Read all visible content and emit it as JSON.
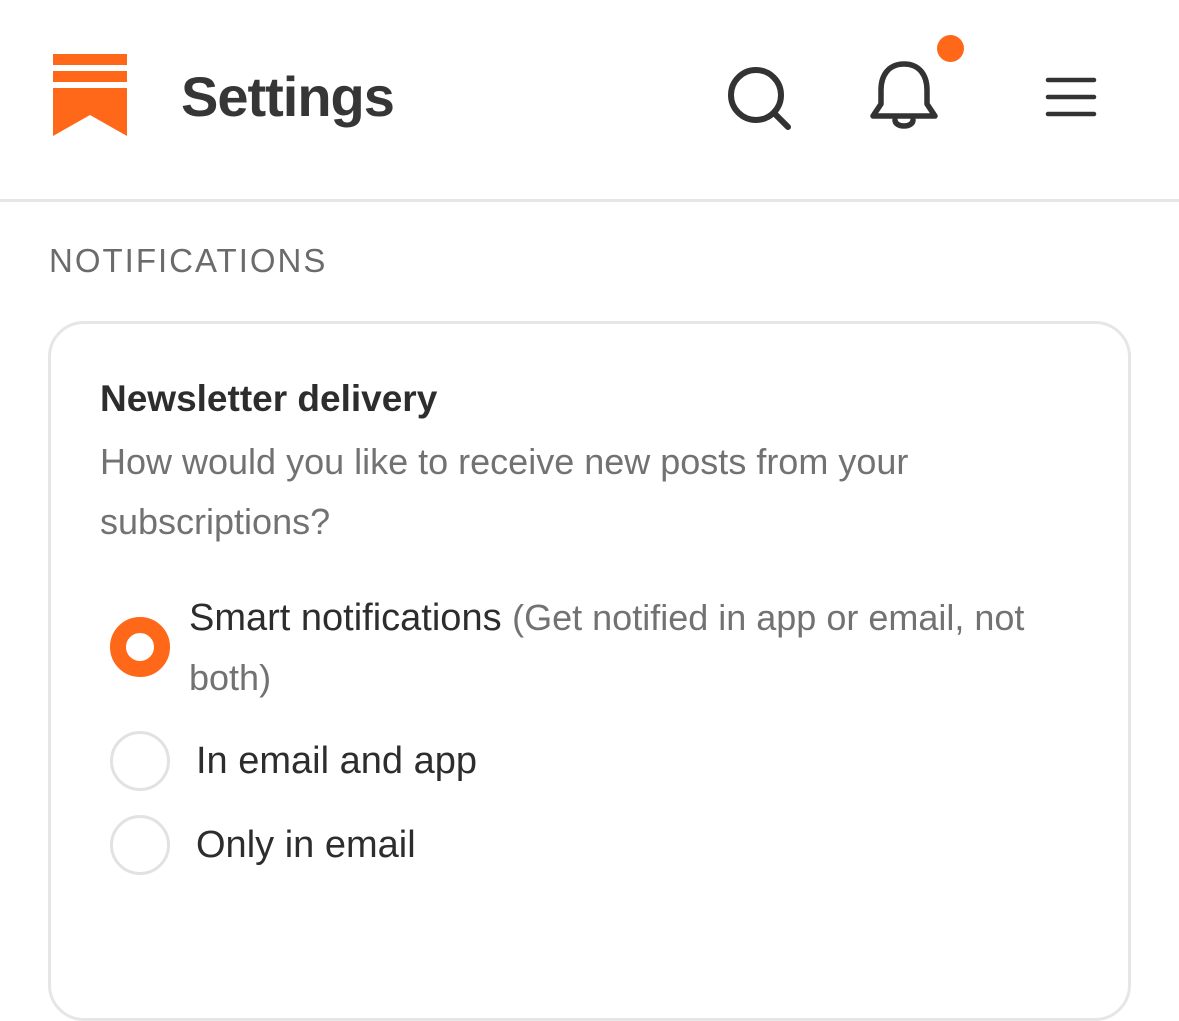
{
  "header": {
    "title": "Settings",
    "logo_icon": "bookmark-logo-icon",
    "search_icon": "search-icon",
    "bell_icon": "bell-icon",
    "menu_icon": "hamburger-menu-icon",
    "has_unread_notifications": true
  },
  "colors": {
    "accent": "#ff6719",
    "text_primary": "#2d2d2d",
    "text_secondary": "#727272",
    "border": "#e6e6e6"
  },
  "section": {
    "label": "NOTIFICATIONS"
  },
  "newsletter_delivery": {
    "title": "Newsletter delivery",
    "description": "How would you like to receive new posts from your subscriptions?",
    "selected_index": 0,
    "options": [
      {
        "label": "Smart notifications",
        "hint": "(Get notified in app or email, not both)",
        "selected": true
      },
      {
        "label": "In email and app",
        "hint": "",
        "selected": false
      },
      {
        "label": "Only in email",
        "hint": "",
        "selected": false
      }
    ]
  }
}
